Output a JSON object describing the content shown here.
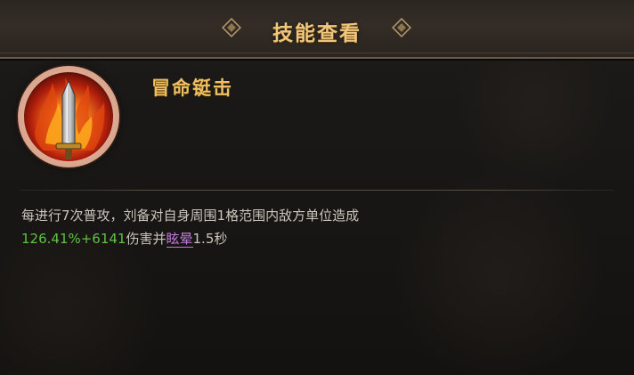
{
  "header": {
    "title": "技能查看",
    "ornament_left_icon": "diamond-ornament-icon",
    "ornament_right_icon": "diamond-ornament-icon"
  },
  "skill": {
    "name": "冒命铤击",
    "icon": "flaming-sword-icon",
    "description_line1": "每进行7次普攻，刘备对自身周围1格范围内敌方单位造成",
    "damage_value": "126.41%+6141",
    "damage_text": "伤害并",
    "status_effect": "眩晕",
    "status_duration": "1.5秒"
  },
  "colors": {
    "title_gold": "#f0c77a",
    "name_gold": "#f0c060",
    "value_green": "#5fc144",
    "status_purple": "#c27adf",
    "text_gray": "#c9c4bc"
  }
}
